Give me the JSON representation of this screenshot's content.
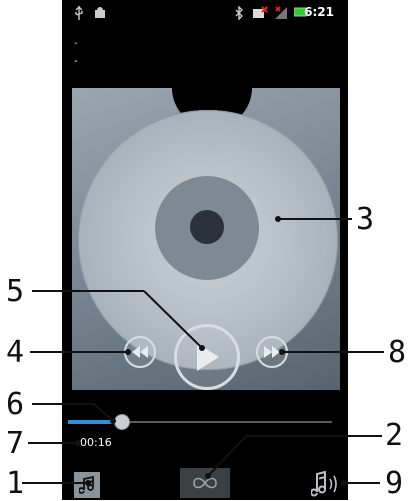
{
  "status_bar": {
    "time": "6:21",
    "icons": [
      "usb-icon",
      "android-debug-icon",
      "bluetooth-icon",
      "no-sim-icon",
      "signal-icon",
      "battery-icon"
    ]
  },
  "track": {
    "title": "-",
    "artist": "-"
  },
  "player": {
    "elapsed": "00:16",
    "progress": 0.2,
    "accent": "#2f8fd8",
    "controls": [
      "previous-button",
      "play-button",
      "next-button"
    ]
  },
  "bottom_bar": {
    "items": [
      "music-library-button",
      "infinite-button",
      "visualizer-button"
    ]
  },
  "callouts": [
    "1",
    "2",
    "3",
    "4",
    "5",
    "6",
    "7",
    "8",
    "9"
  ]
}
